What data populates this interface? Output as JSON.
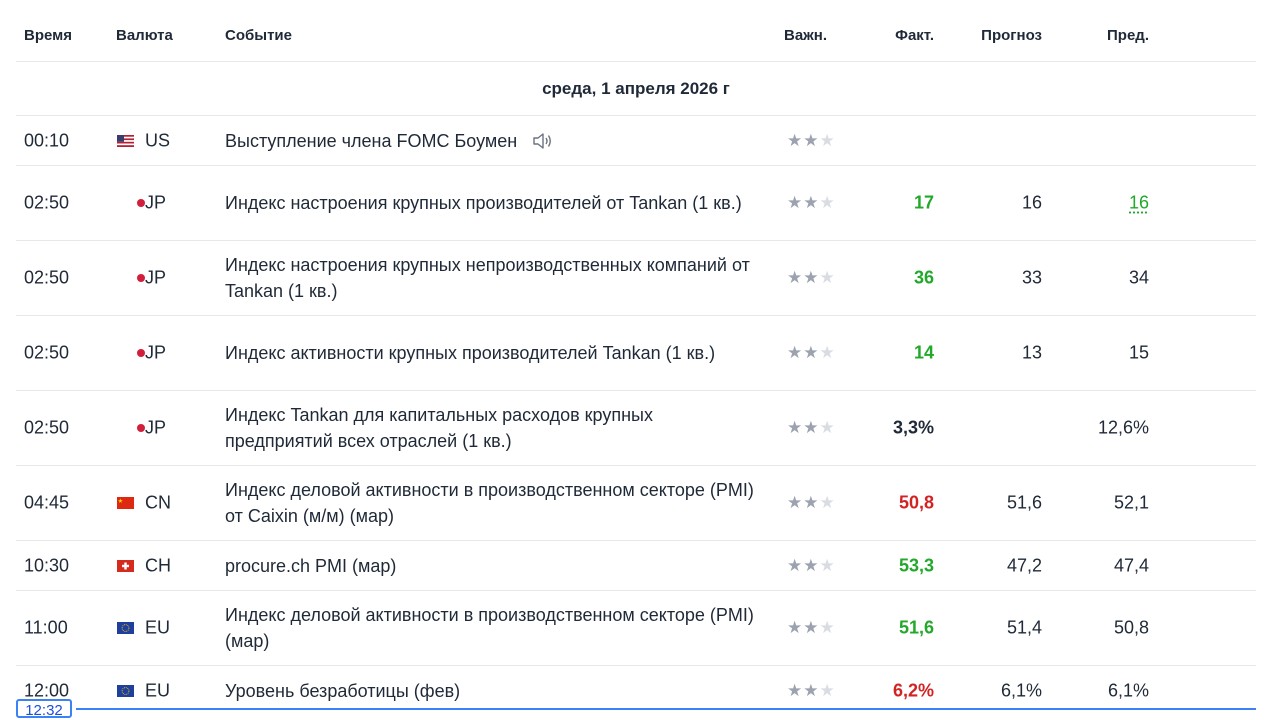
{
  "columns": {
    "time": "Время",
    "currency": "Валюта",
    "event": "Событие",
    "importance": "Важн.",
    "actual": "Факт.",
    "forecast": "Прогноз",
    "previous": "Пред."
  },
  "date_header": "среда, 1 апреля 2026 г",
  "colors": {
    "positive": "#22a82a",
    "negative": "#d32222",
    "accent": "#3b82f6"
  },
  "stars_filled": "★★",
  "stars_empty": "★",
  "rows": [
    {
      "time": "00:10",
      "currency": "US",
      "flag": "us-flag-icon",
      "event": "Выступление члена FOMC Боумен",
      "importance": 2,
      "actual": "",
      "forecast": "",
      "previous": ""
    },
    {
      "time": "02:50",
      "currency": "JP",
      "flag": "jp-flag-icon",
      "event": "Индекс настроения крупных производителей от Tankan (1 кв.)",
      "importance": 2,
      "actual": "17",
      "forecast": "16",
      "previous": "16"
    },
    {
      "time": "02:50",
      "currency": "JP",
      "flag": "jp-flag-icon",
      "event": "Индекс настроения крупных непроизводственных компаний от Tankan (1 кв.)",
      "importance": 2,
      "actual": "36",
      "forecast": "33",
      "previous": "34"
    },
    {
      "time": "02:50",
      "currency": "JP",
      "flag": "jp-flag-icon",
      "event": "Индекс активности крупных производителей Tankan (1 кв.)",
      "importance": 2,
      "actual": "14",
      "forecast": "13",
      "previous": "15"
    },
    {
      "time": "02:50",
      "currency": "JP",
      "flag": "jp-flag-icon",
      "event": "Индекс Tankan для капитальных расходов крупных предприятий всех отраслей (1 кв.)",
      "importance": 2,
      "actual": "3,3%",
      "forecast": "",
      "previous": "12,6%"
    },
    {
      "time": "04:45",
      "currency": "CN",
      "flag": "cn-flag-icon",
      "event": "Индекс деловой активности в производственном секторе (PMI) от Caixin (м/м) (мар)",
      "importance": 2,
      "actual": "50,8",
      "forecast": "51,6",
      "previous": "52,1"
    },
    {
      "time": "10:30",
      "currency": "CH",
      "flag": "ch-flag-icon",
      "event": "procure.ch PMI (мар)",
      "importance": 2,
      "actual": "53,3",
      "forecast": "47,2",
      "previous": "47,4"
    },
    {
      "time": "11:00",
      "currency": "EU",
      "flag": "eu-flag-icon",
      "event": "Индекс деловой активности в производственном секторе (PMI) (мар)",
      "importance": 2,
      "actual": "51,6",
      "forecast": "51,4",
      "previous": "50,8"
    },
    {
      "time": "12:00",
      "currency": "EU",
      "flag": "eu-flag-icon",
      "event": "Уровень безработицы (фев)",
      "importance": 2,
      "actual": "6,2%",
      "forecast": "6,1%",
      "previous": "6,1%"
    }
  ],
  "current_time": "12:32"
}
